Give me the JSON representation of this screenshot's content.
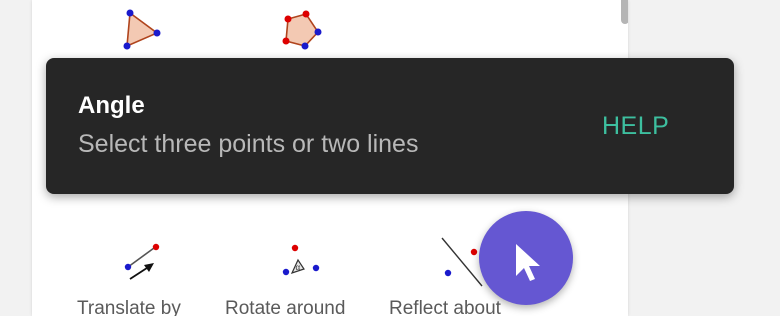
{
  "toast": {
    "title": "Angle",
    "description": "Select three points or two lines",
    "help_label": "HELP"
  },
  "tools": {
    "row1": [
      {
        "icon": "polygon-triangle-icon"
      },
      {
        "icon": "regular-polygon-icon"
      }
    ],
    "row2": [
      {
        "icon": "translate-by-vector-icon",
        "label": "Translate by"
      },
      {
        "icon": "rotate-around-point-icon",
        "label": "Rotate around"
      },
      {
        "icon": "reflect-about-line-icon",
        "label": "Reflect about"
      }
    ]
  },
  "fab": {
    "icon": "move-cursor-icon"
  },
  "colors": {
    "toast_bg": "#262626",
    "help": "#3dbf9f",
    "fab": "#6557d2",
    "point_blue": "#1a1acc",
    "point_red": "#dd0000"
  }
}
